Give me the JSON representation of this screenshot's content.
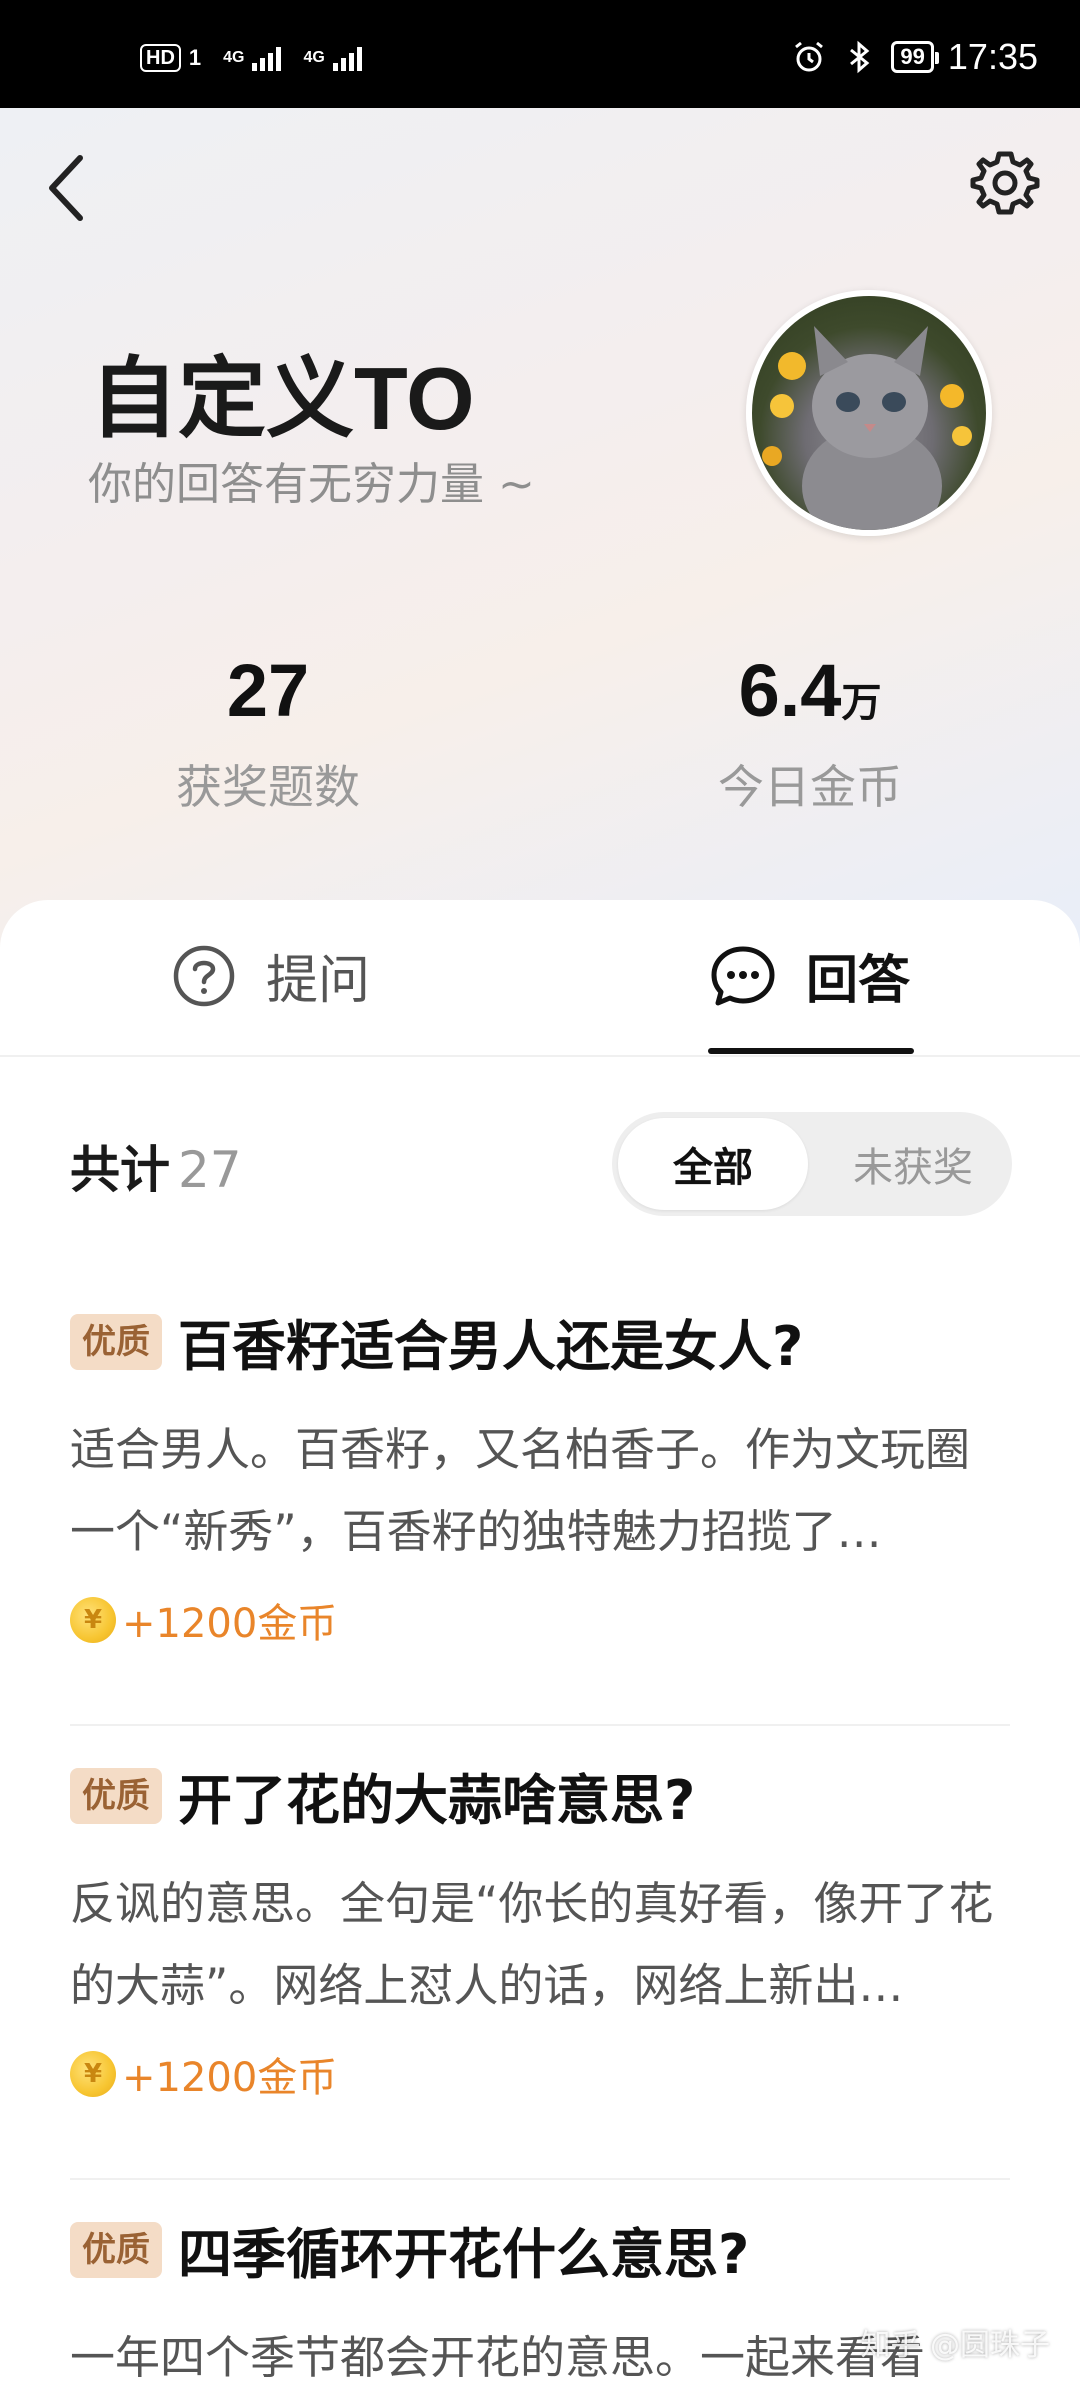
{
  "status_bar": {
    "hd": "HD",
    "sim": "1",
    "net1": "4G",
    "net2": "4G",
    "battery": "99",
    "time": "17:35",
    "icons": [
      "alarm-icon",
      "bluetooth-icon"
    ]
  },
  "header": {
    "back_icon": "chevron-left-icon",
    "settings_icon": "gear-icon",
    "name": "自定义TO",
    "tagline": "你的回答有无穷力量 ~",
    "avatar": "kitten-avatar"
  },
  "stats": [
    {
      "value": "27",
      "unit": "",
      "label": "获奖题数"
    },
    {
      "value": "6.4",
      "unit": "万",
      "label": "今日金币"
    }
  ],
  "tabs": [
    {
      "label": "提问",
      "icon": "question-circle-icon",
      "active": false
    },
    {
      "label": "回答",
      "icon": "chat-bubble-icon",
      "active": true
    }
  ],
  "summary": {
    "label": "共计",
    "count": "27"
  },
  "filter": {
    "all": "全部",
    "unawarded": "未获奖",
    "selected": "全部"
  },
  "items": [
    {
      "badge": "优质",
      "title": "百香籽适合男人还是女人?",
      "excerpt": "适合男人。百香籽，又名柏香子。作为文玩圈一个“新秀”，百香籽的独特魅力招揽了…",
      "reward": "+1200金币"
    },
    {
      "badge": "优质",
      "title": "开了花的大蒜啥意思?",
      "excerpt": "反讽的意思。全句是“你长的真好看，像开了花的大蒜”。网络上怼人的话，网络上新出…",
      "reward": "+1200金币"
    },
    {
      "badge": "优质",
      "title": "四季循环开花什么意思?",
      "excerpt": "一年四个季节都会开花的意思。一起来看看",
      "reward": ""
    }
  ],
  "coin_symbol": "¥",
  "watermark": "知乎 @圆珠子",
  "colors": {
    "badge_bg": "#f4dcc6",
    "badge_text": "#9a6234",
    "reward": "#e9852a",
    "coin": "#f7c531"
  }
}
